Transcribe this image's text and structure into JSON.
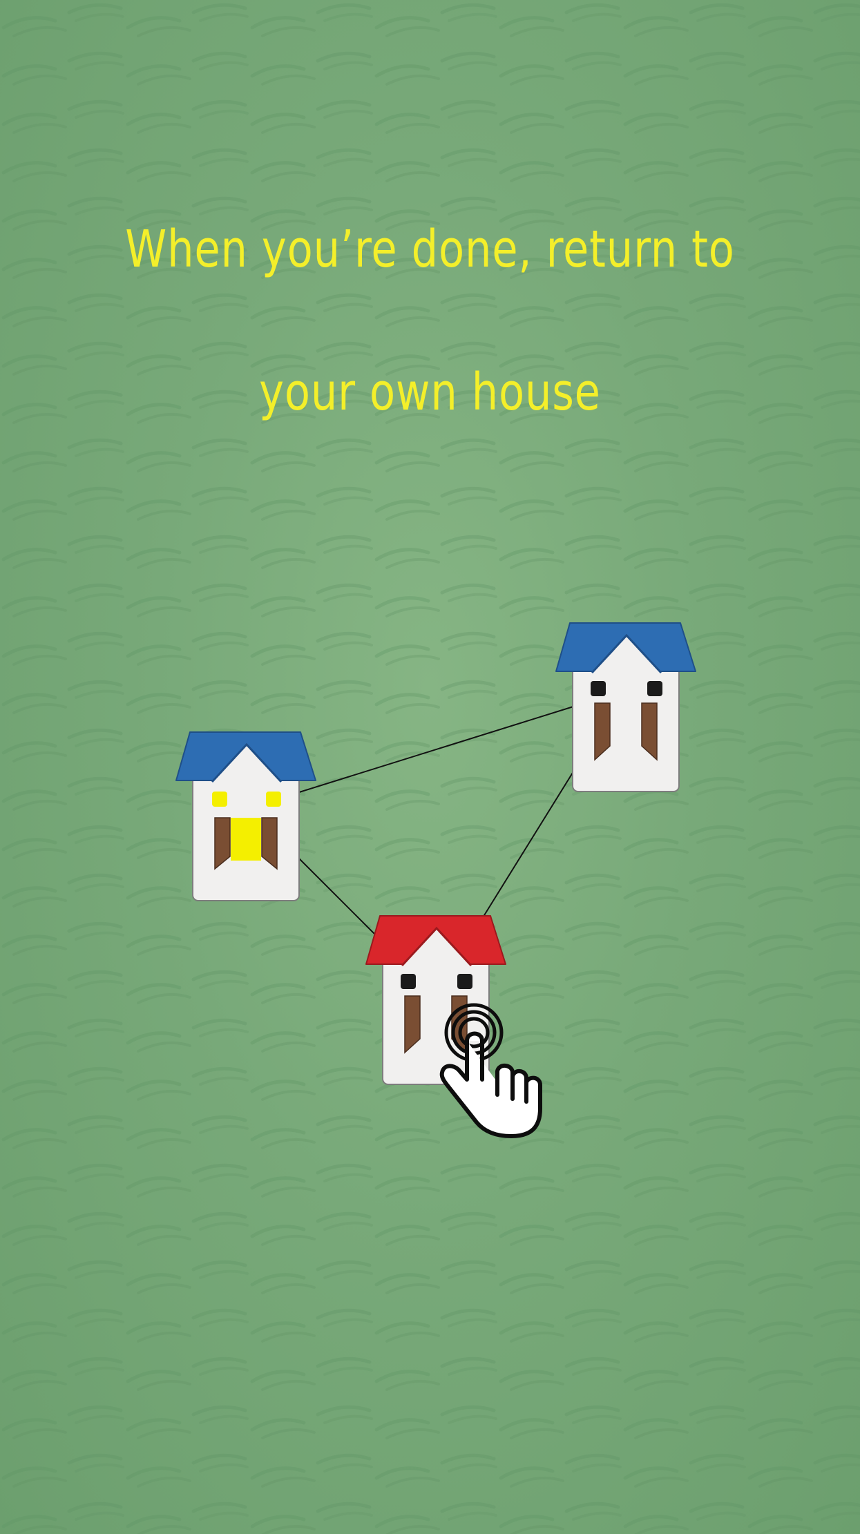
{
  "instruction": {
    "line1": "When you’re done, return to",
    "line2": "your own house"
  },
  "colors": {
    "background": "#78a979",
    "text": "#f4ef2a",
    "blue_roof": "#2d6db3",
    "red_roof": "#d9262b",
    "house_wall": "#f1f0ef",
    "door": "#7a4e33",
    "window_dark": "#1b1b1b",
    "window_lit": "#f4ef00"
  },
  "houses": [
    {
      "id": "lit-house",
      "roof_color": "blue",
      "lit": true
    },
    {
      "id": "neighbor-house",
      "roof_color": "blue",
      "lit": false
    },
    {
      "id": "own-house",
      "roof_color": "red",
      "lit": false
    }
  ],
  "icons": {
    "tap_hint": "tap-hand-icon"
  }
}
